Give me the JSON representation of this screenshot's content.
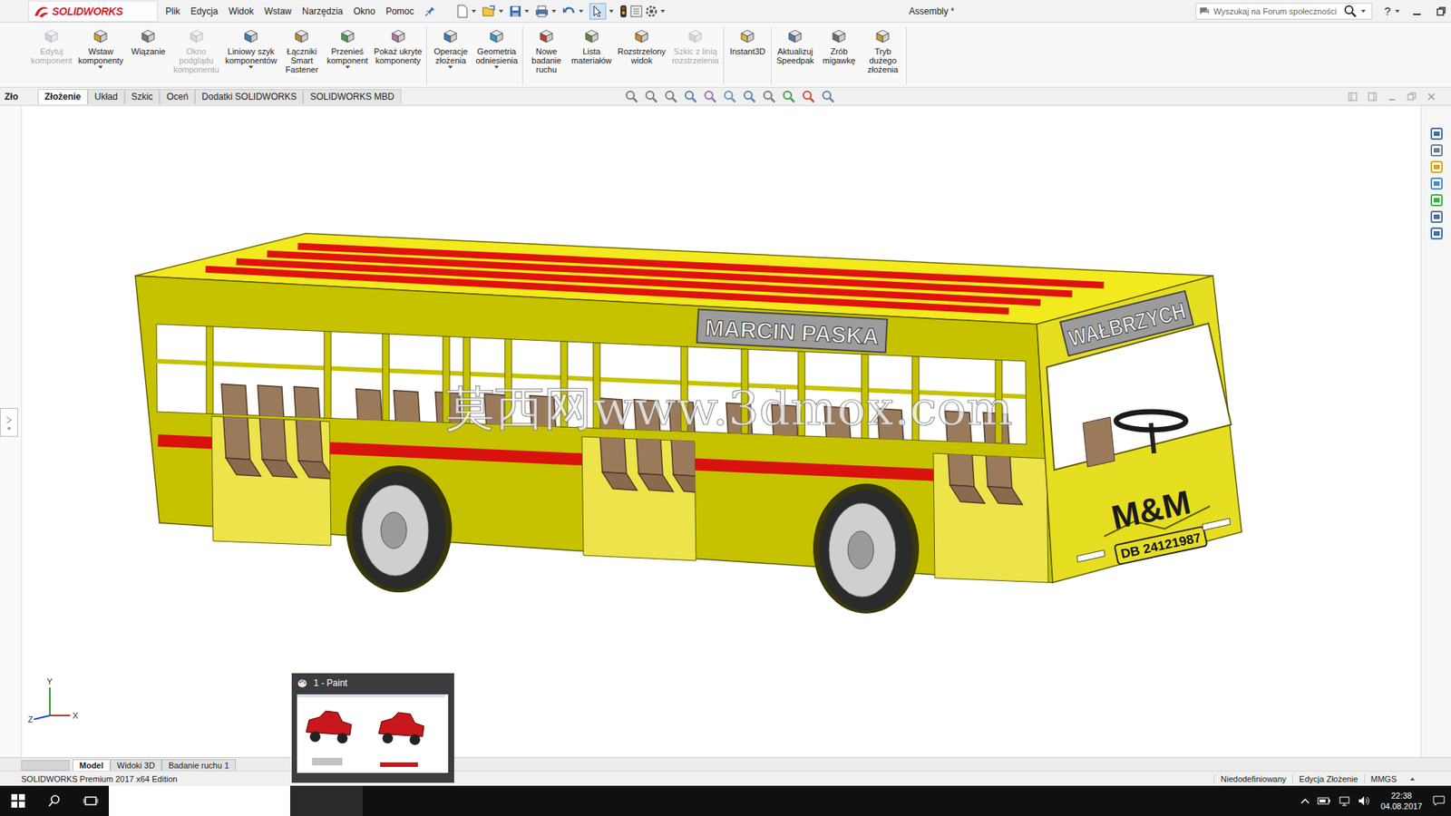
{
  "window": {
    "title": "Assembly *",
    "logo": "SOLIDWORKS"
  },
  "menu": [
    "Plik",
    "Edycja",
    "Widok",
    "Wstaw",
    "Narzędzia",
    "Okno",
    "Pomoc"
  ],
  "search": {
    "placeholder": "Wyszukaj na Forum społeczności"
  },
  "help": "?",
  "ribbon": [
    {
      "buttons": [
        {
          "lines": [
            "Edytuj",
            "komponent"
          ],
          "disabled": true,
          "dropdown": false
        },
        {
          "lines": [
            "Wstaw",
            "komponenty"
          ],
          "disabled": false,
          "dropdown": true
        },
        {
          "lines": [
            "Wiązanie"
          ],
          "disabled": false,
          "dropdown": false
        },
        {
          "lines": [
            "Okno",
            "podglądu",
            "komponentu"
          ],
          "disabled": true,
          "dropdown": false
        },
        {
          "lines": [
            "Liniowy szyk",
            "komponentów"
          ],
          "disabled": false,
          "dropdown": true
        },
        {
          "lines": [
            "Łączniki",
            "Smart",
            "Fastener"
          ],
          "disabled": false,
          "dropdown": false
        },
        {
          "lines": [
            "Przenieś",
            "komponent"
          ],
          "disabled": false,
          "dropdown": true
        },
        {
          "lines": [
            "Pokaż ukryte",
            "komponenty"
          ],
          "disabled": false,
          "dropdown": false
        }
      ]
    },
    {
      "buttons": [
        {
          "lines": [
            "Operacje",
            "złożenia"
          ],
          "disabled": false,
          "dropdown": true
        },
        {
          "lines": [
            "Geometria",
            "odniesienia"
          ],
          "disabled": false,
          "dropdown": true
        }
      ]
    },
    {
      "buttons": [
        {
          "lines": [
            "Nowe",
            "badanie",
            "ruchu"
          ],
          "disabled": false,
          "dropdown": false
        },
        {
          "lines": [
            "Lista",
            "materiałów"
          ],
          "disabled": false,
          "dropdown": false
        },
        {
          "lines": [
            "Rozstrzelony",
            "widok"
          ],
          "disabled": false,
          "dropdown": false
        },
        {
          "lines": [
            "Szkic z linią",
            "rozstrzelenia"
          ],
          "disabled": true,
          "dropdown": false
        }
      ]
    },
    {
      "buttons": [
        {
          "lines": [
            "Instant3D"
          ],
          "disabled": false,
          "dropdown": false
        }
      ]
    },
    {
      "buttons": [
        {
          "lines": [
            "Aktualizuj",
            "Speedpak"
          ],
          "disabled": false,
          "dropdown": false
        },
        {
          "lines": [
            "Zrób",
            "migawkę"
          ],
          "disabled": false,
          "dropdown": false
        },
        {
          "lines": [
            "Tryb",
            "dużego",
            "złożenia"
          ],
          "disabled": false,
          "dropdown": false
        }
      ]
    }
  ],
  "command_tabs": {
    "stub": "Zło",
    "items": [
      {
        "label": "Złożenie",
        "selected": true
      },
      {
        "label": "Układ",
        "selected": false
      },
      {
        "label": "Szkic",
        "selected": false
      },
      {
        "label": "Oceń",
        "selected": false
      },
      {
        "label": "Dodatki SOLIDWORKS",
        "selected": false
      },
      {
        "label": "SOLIDWORKS MBD",
        "selected": false
      }
    ]
  },
  "model_labels": {
    "side_sign": "MARCIN PASKA",
    "destination": "WAŁBRZYCH",
    "badge": "M&M",
    "plate": "DB 24121987"
  },
  "watermark": "莫西网www.3dmox.com",
  "triad": {
    "x": "X",
    "y": "Y",
    "z": "Z"
  },
  "bottom_tabs": [
    {
      "label": "Model",
      "selected": true
    },
    {
      "label": "Widoki 3D",
      "selected": false
    },
    {
      "label": "Badanie ruchu 1",
      "selected": false
    }
  ],
  "status_bar": {
    "edition": "SOLIDWORKS Premium 2017 x64 Edition",
    "items": [
      "Niedodefiniowany",
      "Edycja Złożenie",
      "MMGS"
    ]
  },
  "taskbar_popup": {
    "title": "1 - Paint"
  },
  "taskbar": {
    "apps": [
      {
        "kind": "firefox",
        "active": false
      },
      {
        "kind": "explorer",
        "active": false
      },
      {
        "kind": "store",
        "active": false
      },
      {
        "kind": "mail",
        "active": false
      },
      {
        "kind": "excel",
        "active": false
      },
      {
        "kind": "solidworks",
        "active": true
      },
      {
        "kind": "paint",
        "active": true
      }
    ],
    "time": "22:38",
    "date": "04.08.2017"
  }
}
